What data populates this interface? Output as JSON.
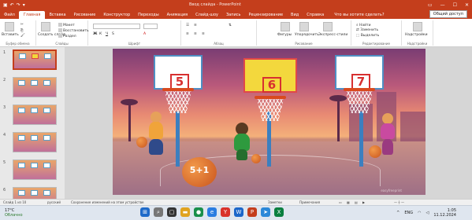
{
  "window": {
    "title": "Ввод слайда - PowerPoint"
  },
  "tabs": [
    {
      "label": "Файл",
      "active": false
    },
    {
      "label": "Главная",
      "active": true
    },
    {
      "label": "Вставка",
      "active": false
    },
    {
      "label": "Рисование",
      "active": false
    },
    {
      "label": "Конструктор",
      "active": false
    },
    {
      "label": "Переходы",
      "active": false
    },
    {
      "label": "Анимация",
      "active": false
    },
    {
      "label": "Слайд-шоу",
      "active": false
    },
    {
      "label": "Запись",
      "active": false
    },
    {
      "label": "Рецензирование",
      "active": false
    },
    {
      "label": "Вид",
      "active": false
    },
    {
      "label": "Справка",
      "active": false
    }
  ],
  "tab_search": "Что вы хотите сделать?",
  "share_label": "Общий доступ",
  "ribbon": {
    "groups": [
      {
        "label": "Буфер обмена"
      },
      {
        "label": "Слайды"
      },
      {
        "label": "Шрифт"
      },
      {
        "label": "Абзац"
      },
      {
        "label": "Рисование"
      },
      {
        "label": "Редактирование"
      },
      {
        "label": "Надстройки"
      }
    ],
    "paste_label": "Вставить",
    "new_slide_label": "Создать слайд",
    "layout_label": "Макет",
    "reset_label": "Восстановить",
    "section_label": "Раздел",
    "shapes_label": "Фигуры",
    "arrange_label": "Упорядочить",
    "quick_styles_label": "Экспресс-стили",
    "find_label": "Найти",
    "replace_label": "Заменить",
    "select_label": "Выделить",
    "addins_label": "Надстройки"
  },
  "thumbnails": [
    "1",
    "2",
    "3",
    "4",
    "5",
    "6"
  ],
  "slide": {
    "hoops": [
      {
        "number": "5",
        "style": "white"
      },
      {
        "number": "6",
        "style": "yellow"
      },
      {
        "number": "7",
        "style": "white"
      }
    ],
    "ball_label": "5+1",
    "watermark": "easyfreeprint"
  },
  "status": {
    "slide_info": "Слайд 1 из 10",
    "language": "русский",
    "message": "Сохранение изменений на этом устройстве",
    "notes": "Заметки",
    "comments": "Примечания"
  },
  "taskbar": {
    "temp": "17°C",
    "weather": "Облачно",
    "lang": "ENG",
    "time": "1:05",
    "date": "11.12.2024"
  }
}
